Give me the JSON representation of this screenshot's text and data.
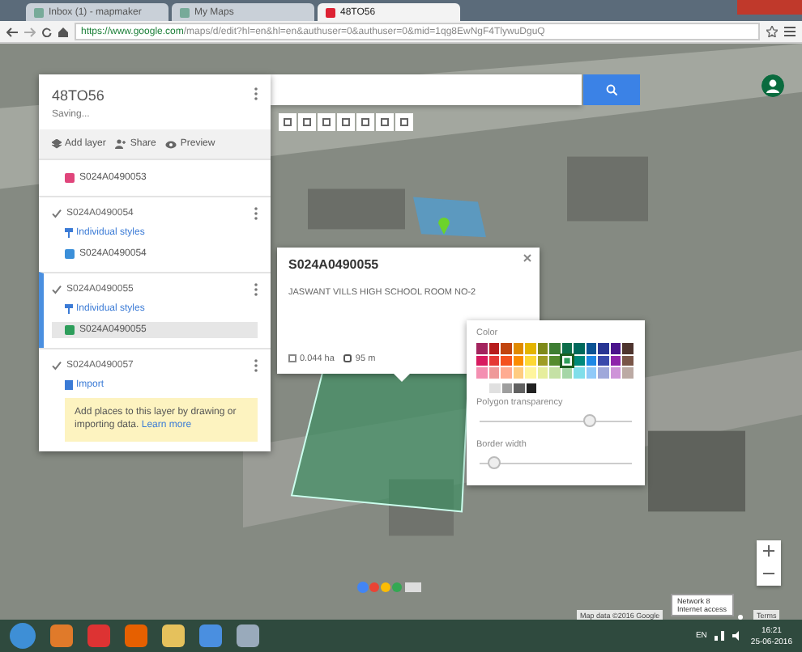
{
  "browser": {
    "tabs": [
      {
        "title": "Inbox (1) - mapmaker",
        "selected": false
      },
      {
        "title": "My Maps",
        "selected": false
      },
      {
        "title": "48TO56",
        "selected": true
      }
    ],
    "url_host": "https://www.google.com",
    "url_path": "/maps/d/edit?hl=en&hl=en&authuser=0&authuser=0&mid=1qg8EwNgF4TlywuDguQ"
  },
  "panel": {
    "title": "48TO56",
    "status": "Saving...",
    "actions": [
      "Add layer",
      "Share",
      "Preview"
    ],
    "layers": [
      {
        "items": [
          {
            "label": "S024A0490053",
            "color": "#e0457b",
            "selected": false
          }
        ]
      },
      {
        "name": "S024A0490054",
        "checked": true,
        "style": "Individual styles",
        "items": [
          {
            "label": "S024A0490054",
            "color": "#3b8fd9",
            "selected": false
          }
        ]
      },
      {
        "name": "S024A0490055",
        "checked": true,
        "style": "Individual styles",
        "items": [
          {
            "label": "S024A0490055",
            "color": "#2e9e5b",
            "selected": true
          }
        ]
      },
      {
        "name": "S024A0490057",
        "checked": true,
        "style": "Import",
        "hint": "Add places to this layer by drawing or importing data.",
        "hint_link": "Learn more"
      }
    ]
  },
  "popup": {
    "title": "S024A0490055",
    "description": "JASWANT VILLS HIGH SCHOOL ROOM NO-2",
    "area": "0.044 ha",
    "perimeter": "95 m"
  },
  "style_menu": {
    "color_label": "Color",
    "swatches": [
      {
        "color": "#a3245e",
        "selected": false
      },
      {
        "color": "#b71c1c",
        "selected": false
      },
      {
        "color": "#c1440e",
        "selected": false
      },
      {
        "color": "#e08a00",
        "selected": false
      },
      {
        "color": "#e4b400",
        "selected": false
      },
      {
        "color": "#7e8a1a",
        "selected": false
      },
      {
        "color": "#3e7d33",
        "selected": false
      },
      {
        "color": "#0d6e4a",
        "selected": false
      },
      {
        "color": "#00695c",
        "selected": false
      },
      {
        "color": "#0b5394",
        "selected": false
      },
      {
        "color": "#283593",
        "selected": false
      },
      {
        "color": "#4a148c",
        "selected": false
      },
      {
        "color": "#4e342e",
        "selected": false
      },
      {
        "color": "#d81b60",
        "selected": false
      },
      {
        "color": "#e53935",
        "selected": false
      },
      {
        "color": "#f4511e",
        "selected": false
      },
      {
        "color": "#fb8c00",
        "selected": false
      },
      {
        "color": "#fdd835",
        "selected": false
      },
      {
        "color": "#9e9d24",
        "selected": false
      },
      {
        "color": "#558b2f",
        "selected": false
      },
      {
        "color": "#2e9e5b",
        "selected": true
      },
      {
        "color": "#00897b",
        "selected": false
      },
      {
        "color": "#1e88e5",
        "selected": false
      },
      {
        "color": "#3949ab",
        "selected": false
      },
      {
        "color": "#8e24aa",
        "selected": false
      },
      {
        "color": "#795548",
        "selected": false
      },
      {
        "color": "#f48fb1",
        "selected": false
      },
      {
        "color": "#ef9a9a",
        "selected": false
      },
      {
        "color": "#ffab91",
        "selected": false
      },
      {
        "color": "#ffcc80",
        "selected": false
      },
      {
        "color": "#fff59d",
        "selected": false
      },
      {
        "color": "#e6ee9c",
        "selected": false
      },
      {
        "color": "#c5e1a5",
        "selected": false
      },
      {
        "color": "#a5d6a7",
        "selected": false
      },
      {
        "color": "#80deea",
        "selected": false
      },
      {
        "color": "#90caf9",
        "selected": false
      },
      {
        "color": "#9fa8da",
        "selected": false
      },
      {
        "color": "#ce93d8",
        "selected": false
      },
      {
        "color": "#bcaaa4",
        "selected": false
      },
      {
        "color": "#e0e0e0",
        "selected": false
      },
      {
        "color": "#9e9e9e",
        "selected": false
      },
      {
        "color": "#616161",
        "selected": false
      },
      {
        "color": "#212121",
        "selected": false
      }
    ],
    "transparency_label": "Polygon transparency",
    "transparency": {
      "level": 0.72
    },
    "border_label": "Border width",
    "border": {
      "level": 0.1
    }
  },
  "map_footer": {
    "attribution": "Map data ©2016 Google",
    "terms": "Terms"
  },
  "network_tooltip": [
    "Network  8",
    "Internet access"
  ],
  "taskbar": {
    "language": "EN",
    "time": "16:21",
    "date": "25-06-2016"
  }
}
